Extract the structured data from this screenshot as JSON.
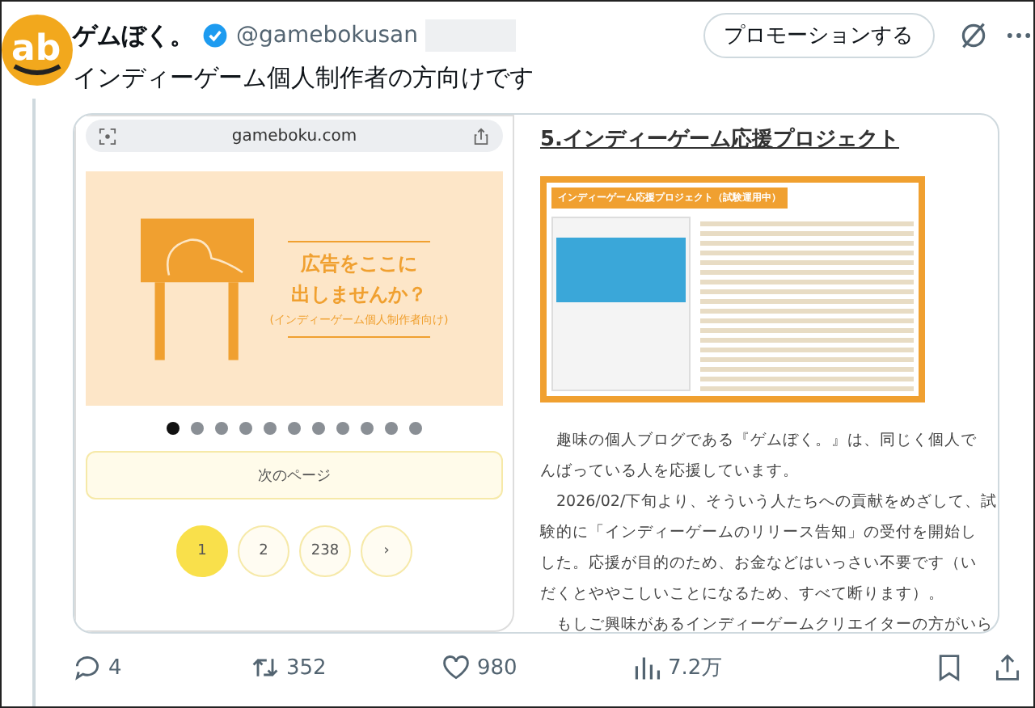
{
  "post": {
    "logo": "ab",
    "name": "ゲムぼく。",
    "handle": "@gamebokusan",
    "promo_button": "プロモーションする",
    "text": "インディーゲーム個人制作者の方向けです"
  },
  "phone": {
    "url": "gameboku.com",
    "ad_lines": [
      "広告をここに",
      "出しませんか？"
    ],
    "ad_note": "(インディーゲーム個人制作者向け)",
    "dots": [
      {
        "selected": true
      },
      {
        "selected": false
      },
      {
        "selected": false
      },
      {
        "selected": false
      },
      {
        "selected": false
      },
      {
        "selected": false
      },
      {
        "selected": false
      },
      {
        "selected": false
      },
      {
        "selected": false
      },
      {
        "selected": false
      },
      {
        "selected": false
      }
    ],
    "next_page": "次のページ",
    "pages": [
      {
        "label": "1",
        "selected": true
      },
      {
        "label": "2",
        "selected": false
      },
      {
        "label": "238",
        "selected": false
      },
      {
        "label": "›",
        "selected": false
      }
    ]
  },
  "article": {
    "heading": "5.インディーゲーム応援プロジェクト",
    "banner_title": "インディーゲーム応援プロジェクト（試験運用中）",
    "lines": [
      {
        "text": "趣味の個人ブログである『ゲムぼく。』は、同じく個人で",
        "indent": true
      },
      {
        "text": "んばっている人を応援しています。",
        "indent": false
      },
      {
        "text": "2026/02/下旬より、そういう人たちへの貢献をめざして、試",
        "indent": true
      },
      {
        "text": "験的に「インディーゲームのリリース告知」の受付を開始し",
        "indent": false
      },
      {
        "text": "した。応援が目的のため、お金などはいっさい不要です（い",
        "indent": false
      },
      {
        "text": "だくとややこしいことになるため、すべて断ります）。",
        "indent": false
      },
      {
        "text": "もしご興味があるインディーゲームクリエイターの方がいら",
        "indent": true
      }
    ]
  },
  "actions": {
    "replies": "4",
    "reposts": "352",
    "likes": "980",
    "views": "7.2万"
  }
}
